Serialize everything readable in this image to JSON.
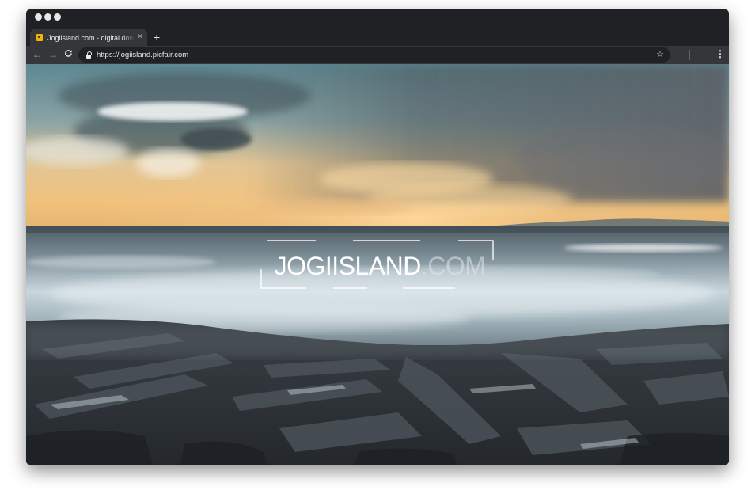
{
  "browser": {
    "tab": {
      "title": "Jogiisland.com - digital downlo",
      "close_glyph": "×",
      "favicon": "picfair-favicon-icon"
    },
    "new_tab_glyph": "+",
    "toolbar": {
      "back_glyph": "←",
      "forward_glyph": "→",
      "reload_glyph": "C",
      "url": "https://jogiisland.picfair.com",
      "star_glyph": "☆",
      "menu_glyph": "⋮"
    }
  },
  "hero": {
    "logo_main": "JOGIISLAND",
    "logo_tld": ".COM",
    "image": "seascape-sunset-rocky-shore"
  },
  "colors": {
    "chrome_dark": "#202124",
    "chrome_toolbar": "#35363a",
    "favicon": "#f2b400"
  }
}
